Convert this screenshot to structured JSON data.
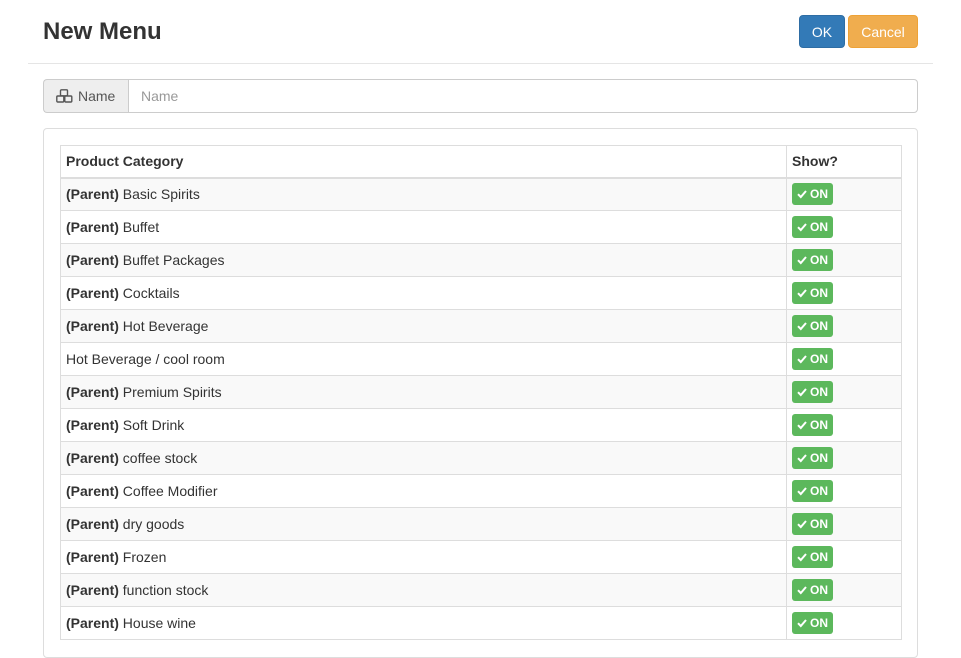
{
  "header": {
    "title": "New Menu",
    "ok_label": "OK",
    "cancel_label": "Cancel"
  },
  "name_field": {
    "addon_icon": "cubes-icon",
    "addon_label": "Name",
    "value": "",
    "placeholder": "Name"
  },
  "table": {
    "headers": [
      "Product Category",
      "Show?"
    ],
    "rows": [
      {
        "prefix": "(Parent)",
        "name": "Basic Spirits",
        "show": "ON"
      },
      {
        "prefix": "(Parent)",
        "name": "Buffet",
        "show": "ON"
      },
      {
        "prefix": "(Parent)",
        "name": "Buffet Packages",
        "show": "ON"
      },
      {
        "prefix": "(Parent)",
        "name": "Cocktails",
        "show": "ON"
      },
      {
        "prefix": "(Parent)",
        "name": "Hot Beverage",
        "show": "ON"
      },
      {
        "prefix": "",
        "name": "Hot Beverage / cool room",
        "show": "ON"
      },
      {
        "prefix": "(Parent)",
        "name": "Premium Spirits",
        "show": "ON"
      },
      {
        "prefix": "(Parent)",
        "name": "Soft Drink",
        "show": "ON"
      },
      {
        "prefix": "(Parent)",
        "name": "coffee stock",
        "show": "ON"
      },
      {
        "prefix": "(Parent)",
        "name": "Coffee Modifier",
        "show": "ON"
      },
      {
        "prefix": "(Parent)",
        "name": "dry goods",
        "show": "ON"
      },
      {
        "prefix": "(Parent)",
        "name": "Frozen",
        "show": "ON"
      },
      {
        "prefix": "(Parent)",
        "name": "function stock",
        "show": "ON"
      },
      {
        "prefix": "(Parent)",
        "name": "House wine",
        "show": "ON"
      }
    ]
  },
  "colors": {
    "primary": "#337ab7",
    "warning": "#f0ad4e",
    "success": "#5cb85c"
  }
}
